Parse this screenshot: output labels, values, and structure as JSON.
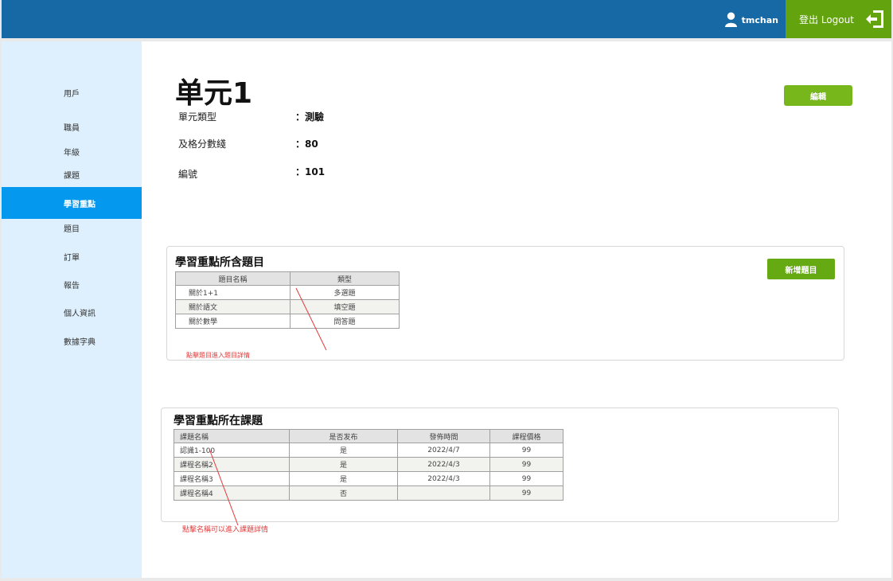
{
  "header": {
    "username": "tmchan",
    "logout_label": "登出 Logout"
  },
  "sidebar": {
    "items": [
      {
        "label": "用戶"
      },
      {
        "label": "職員"
      },
      {
        "label": "年級"
      },
      {
        "label": "課題"
      },
      {
        "label": "學習重點",
        "active": true
      },
      {
        "label": "題目"
      },
      {
        "label": "訂單"
      },
      {
        "label": "報告"
      },
      {
        "label": "個人資訊"
      },
      {
        "label": "數據字典"
      }
    ]
  },
  "main": {
    "title": "单元1",
    "edit_label": "編輯",
    "info": [
      {
        "label": "單元類型",
        "value": "：測驗"
      },
      {
        "label": "及格分數綫",
        "value": "：80"
      },
      {
        "label": "編號",
        "value": "：101"
      }
    ]
  },
  "questions": {
    "title": "學習重點所含題目",
    "add_label": "新增題目",
    "headers": [
      "題目名稱",
      "類型"
    ],
    "rows": [
      [
        "關於1+1",
        "多選題"
      ],
      [
        "關於語文",
        "填空題"
      ],
      [
        "關於數學",
        "問答題"
      ]
    ],
    "annotation": "點擊題目進入題目詳情"
  },
  "courses": {
    "title": "學習重點所在課題",
    "headers": [
      "課題名稱",
      "是否发布",
      "發佈時間",
      "課程價格"
    ],
    "rows": [
      [
        "認識1-100",
        "是",
        "2022/4/7",
        "99"
      ],
      [
        "課程名稱2",
        "是",
        "2022/4/3",
        "99"
      ],
      [
        "課程名稱3",
        "是",
        "2022/4/3",
        "99"
      ],
      [
        "課程名稱4",
        "否",
        "",
        "99"
      ]
    ],
    "annotation": "點擊名稱可以進入課題詳情"
  },
  "colors": {
    "header": "#1769a5",
    "logout": "#63a30e",
    "sidebar": "#def0fd",
    "active": "#0499ee",
    "button": "#66aa13"
  }
}
